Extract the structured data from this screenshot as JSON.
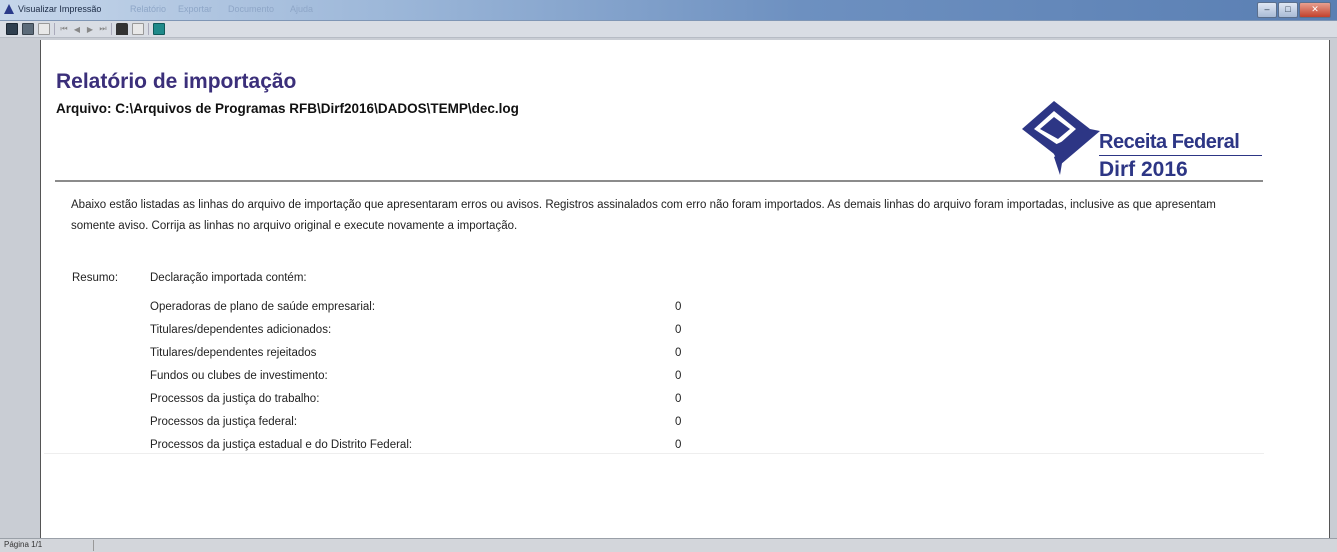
{
  "window": {
    "title": "Visualizar Impressão",
    "title_ghost": [
      "Relatório",
      "Exportar",
      "Documento",
      "Ajuda"
    ],
    "controls": {
      "minimize": "–",
      "maximize": "□",
      "close": "✕"
    }
  },
  "toolbar": {
    "nav": {
      "first": "⏮",
      "prev": "◀",
      "next": "▶",
      "last": "⏭"
    }
  },
  "report": {
    "title": "Relatório de importação",
    "file_line": "Arquivo: C:\\Arquivos de Programas RFB\\Dirf2016\\DADOS\\TEMP\\dec.log",
    "intro": "Abaixo estão listadas as linhas do arquivo de importação que apresentaram erros ou avisos. Registros assinalados com erro não foram importados. As demais linhas do arquivo foram importadas, inclusive as que apresentam somente aviso. Corrija as linhas no arquivo original e execute novamente a importação.",
    "resumo_label": "Resumo:",
    "resumo_heading": "Declaração importada contém:",
    "rows": [
      {
        "label": "Operadoras de plano de saúde empresarial:",
        "value": "0"
      },
      {
        "label": "Titulares/dependentes adicionados:",
        "value": "0"
      },
      {
        "label": "Titulares/dependentes rejeitados",
        "value": "0"
      },
      {
        "label": "Fundos ou clubes de investimento:",
        "value": "0"
      },
      {
        "label": "Processos da justiça do trabalho:",
        "value": "0"
      },
      {
        "label": "Processos da justiça federal:",
        "value": "0"
      },
      {
        "label": "Processos da justiça estadual e do Distrito Federal:",
        "value": "0"
      }
    ]
  },
  "logo": {
    "line1": "Receita Federal",
    "line2": "Dirf 2016",
    "color": "#2d3685"
  },
  "status": {
    "page": "Página 1/1"
  }
}
